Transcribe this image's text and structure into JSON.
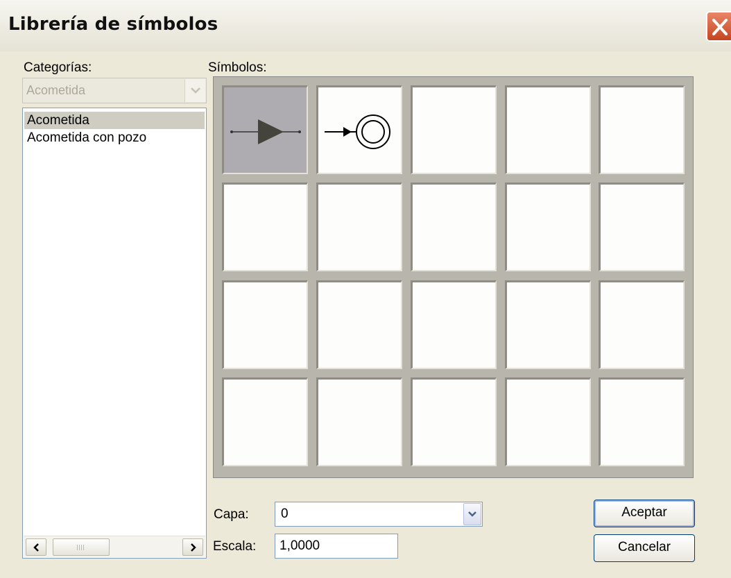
{
  "window": {
    "title": "Librería de símbolos"
  },
  "categories": {
    "label": "Categorías:",
    "selected": "Acometida",
    "items": [
      "Acometida",
      "Acometida con pozo"
    ],
    "selected_index": 0
  },
  "symbols": {
    "label": "Símbolos:",
    "columns": 5,
    "rows": 4,
    "cells": [
      {
        "icon": "arrow-triangle-line-symbol",
        "selected": true
      },
      {
        "icon": "arrow-double-circle-symbol",
        "selected": false
      }
    ]
  },
  "capa": {
    "label": "Capa:",
    "value": "0"
  },
  "escala": {
    "label": "Escala:",
    "value": "1,0000"
  },
  "buttons": {
    "accept": "Aceptar",
    "cancel": "Cancelar"
  },
  "colors": {
    "selected_cell": "#aeacb0",
    "close_button": "#d2532d",
    "window_bg": "#ece9d8"
  }
}
